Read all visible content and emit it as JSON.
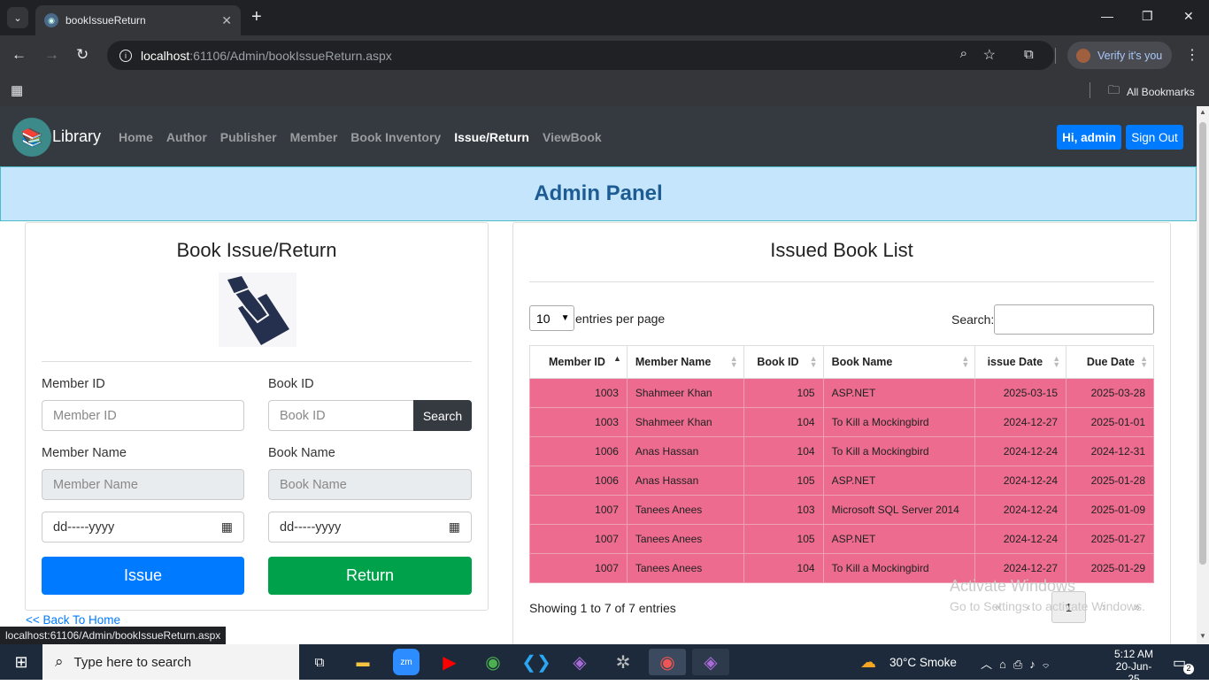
{
  "browser": {
    "tab_title": "bookIssueReturn",
    "url_host": "localhost",
    "url_path": ":61106/Admin/bookIssueReturn.aspx",
    "verify_label": "Verify it's you",
    "all_bookmarks": "All Bookmarks",
    "status_url": "localhost:61106/Admin/bookIssueReturn.aspx"
  },
  "navbar": {
    "brand": "Library",
    "links": [
      "Home",
      "Author",
      "Publisher",
      "Member",
      "Book Inventory",
      "Issue/Return",
      "ViewBook"
    ],
    "active_index": 5,
    "greeting": "Hi, admin",
    "signout": "Sign Out"
  },
  "banner": {
    "title": "Admin Panel"
  },
  "left": {
    "title": "Book Issue/Return",
    "member_id_label": "Member ID",
    "member_id_placeholder": "Member ID",
    "book_id_label": "Book ID",
    "book_id_placeholder": "Book ID",
    "search_button": "Search",
    "member_name_label": "Member Name",
    "member_name_placeholder": "Member Name",
    "book_name_label": "Book Name",
    "book_name_placeholder": "Book Name",
    "date_placeholder_1": "dd-----yyyy",
    "date_placeholder_2": "dd-----yyyy",
    "issue_button": "Issue",
    "return_button": "Return",
    "back_link": "<< Back To Home"
  },
  "right": {
    "title": "Issued Book List",
    "entries_value": "10",
    "entries_label": "entries per page",
    "search_label": "Search:",
    "columns": [
      "Member ID",
      "Member Name",
      "Book ID",
      "Book Name",
      "issue Date",
      "Due Date"
    ],
    "rows": [
      [
        "1003",
        "Shahmeer Khan",
        "105",
        "ASP.NET",
        "2025-03-15",
        "2025-03-28"
      ],
      [
        "1003",
        "Shahmeer Khan",
        "104",
        "To Kill a Mockingbird",
        "2024-12-27",
        "2025-01-01"
      ],
      [
        "1006",
        "Anas Hassan",
        "104",
        "To Kill a Mockingbird",
        "2024-12-24",
        "2024-12-31"
      ],
      [
        "1006",
        "Anas Hassan",
        "105",
        "ASP.NET",
        "2024-12-24",
        "2025-01-28"
      ],
      [
        "1007",
        "Tanees Anees",
        "103",
        "Microsoft SQL Server 2014",
        "2024-12-24",
        "2025-01-09"
      ],
      [
        "1007",
        "Tanees Anees",
        "105",
        "ASP.NET",
        "2024-12-24",
        "2025-01-27"
      ],
      [
        "1007",
        "Tanees Anees",
        "104",
        "To Kill a Mockingbird",
        "2024-12-27",
        "2025-01-29"
      ]
    ],
    "footer": "Showing 1 to 7 of 7 entries",
    "page_current": "1",
    "page_prev_first": "«",
    "page_prev": "‹",
    "page_next": "›",
    "page_last": "»"
  },
  "watermark": {
    "line1": "Activate Windows",
    "line2": "Go to Settings to activate Windows."
  },
  "taskbar": {
    "search_placeholder": "Type here to search",
    "weather": "30°C  Smoke",
    "time": "5:12 AM",
    "date": "20-Jun-25",
    "notif_count": "2"
  },
  "colors": {
    "row_bg": "#ec6b8e",
    "navbar": "#343a40",
    "banner": "#c4e5fb",
    "issue": "#007bff",
    "return": "#00a14b"
  }
}
